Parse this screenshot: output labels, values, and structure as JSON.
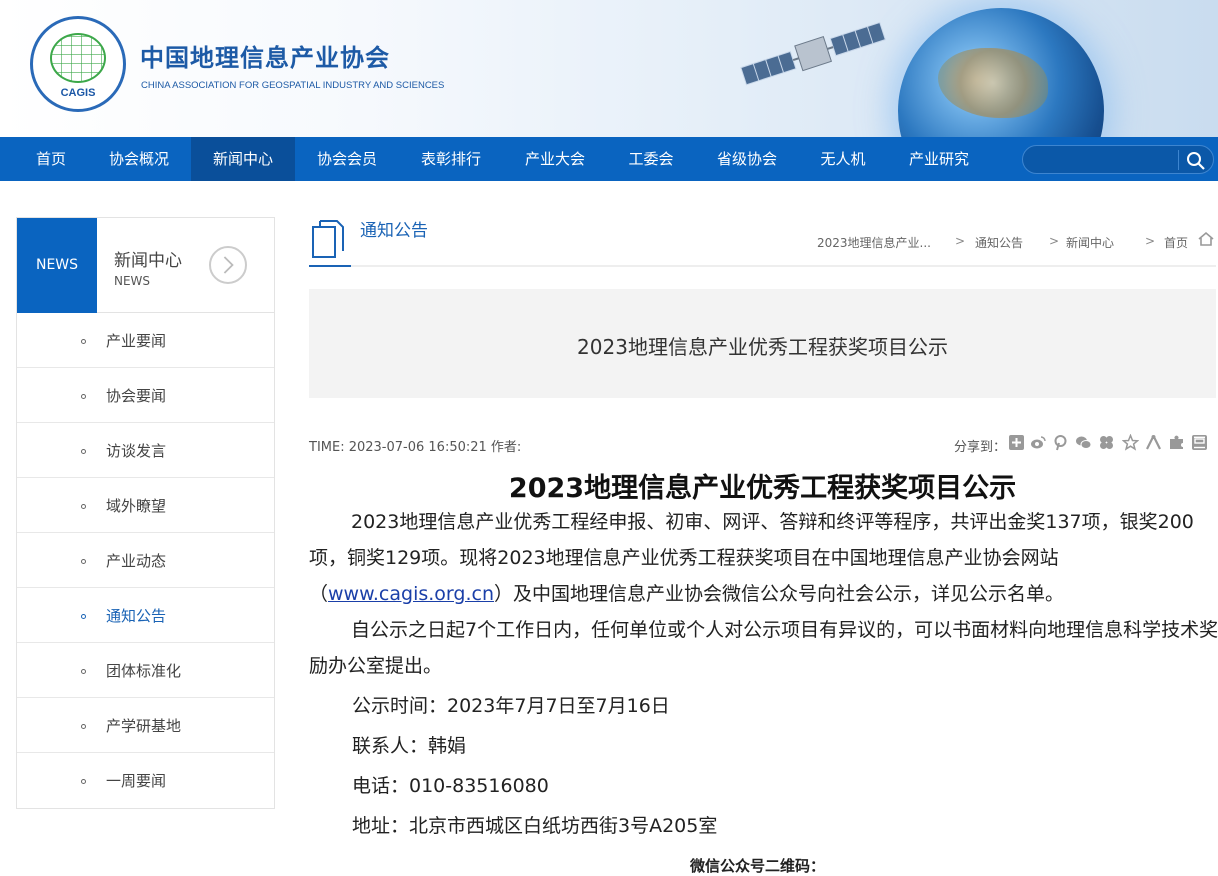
{
  "header": {
    "site_title": "中国地理信息产业协会",
    "site_subtitle": "CHINA ASSOCIATION FOR GEOSPATIAL INDUSTRY AND SCIENCES",
    "logo_text": "CAGIS"
  },
  "nav": {
    "items": [
      "首页",
      "协会概况",
      "新闻中心",
      "协会会员",
      "表彰排行",
      "产业大会",
      "工委会",
      "省级协会",
      "无人机",
      "产业研究"
    ],
    "active_index": 2,
    "search_placeholder": ""
  },
  "sidebar": {
    "badge": "NEWS",
    "title": "新闻中心",
    "subtitle": "NEWS",
    "items": [
      "产业要闻",
      "协会要闻",
      "访谈发言",
      "域外瞭望",
      "产业动态",
      "通知公告",
      "团体标准化",
      "产学研基地",
      "一周要闻"
    ],
    "active_index": 5
  },
  "breadcrumb": {
    "section_title": "通知公告",
    "links": [
      "2023地理信息产业...",
      "通知公告",
      "新闻中心",
      "首页"
    ],
    "separator": ">"
  },
  "article": {
    "banner_title": "2023地理信息产业优秀工程获奖项目公示",
    "meta": "TIME: 2023-07-06 16:50:21 作者:",
    "share_label": "分享到：",
    "share_icons": [
      "qzone-icon",
      "weibo-icon",
      "pinterest-icon",
      "wechat-icon",
      "clover-icon",
      "star-icon",
      "people-icon",
      "puzzle-icon",
      "douban-icon"
    ],
    "title": "2023地理信息产业优秀工程获奖项目公示",
    "para1_a": "2023地理信息产业优秀工程经申报、初审、网评、答辩和终评等程序，共评出金奖137项，银奖200项，铜奖129项。现将2023地理信息产业优秀工程获奖项目在中国地理信息产业协会网站（",
    "para1_link": "www.cagis.org.cn",
    "para1_b": "）及中国地理信息产业协会微信公众号向社会公示，详见公示名单。",
    "para2": "自公示之日起7个工作日内，任何单位或个人对公示项目有异议的，可以书面材料向地理信息科学技术奖励办公室提出。",
    "time_line": "公示时间：2023年7月7日至7月16日",
    "contact_line": "联系人：韩娟",
    "phone_line": "电话：010-83516080",
    "address_line": "地址：北京市西城区白纸坊西街3号A205室",
    "qr_label": "微信公众号二维码："
  },
  "colors": {
    "nav_bg": "#0a64c0",
    "nav_active": "#0a4f9a",
    "link": "#1a63b5"
  }
}
